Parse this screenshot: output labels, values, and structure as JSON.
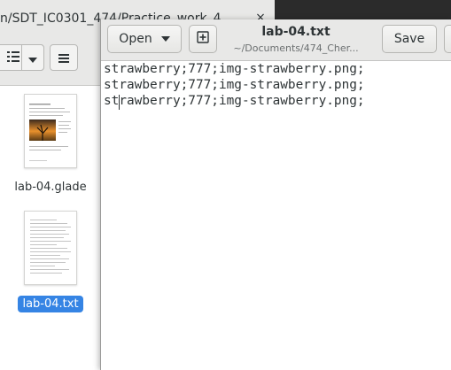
{
  "file_manager": {
    "path": "n/SDT_IC0301_474/Practice_work_4",
    "close_glyph": "×",
    "files": [
      {
        "name": "lab-04.glade",
        "selected": false
      },
      {
        "name": "lab-04.txt",
        "selected": true
      }
    ]
  },
  "editor_window": {
    "open_label": "Open",
    "save_label": "Save",
    "title": "lab-04.txt",
    "subtitle": "~/Documents/474_Cher...",
    "lines": [
      "strawberry;777;img-strawberry.png;",
      "strawberry;777;img-strawberry.png;",
      "strawberry;777;img-strawberry.png;"
    ]
  },
  "icons": {
    "view_list": "view-list-icon",
    "chevron": "chevron-down-icon",
    "menu": "hamburger-menu-icon",
    "new_doc": "new-document-icon"
  }
}
